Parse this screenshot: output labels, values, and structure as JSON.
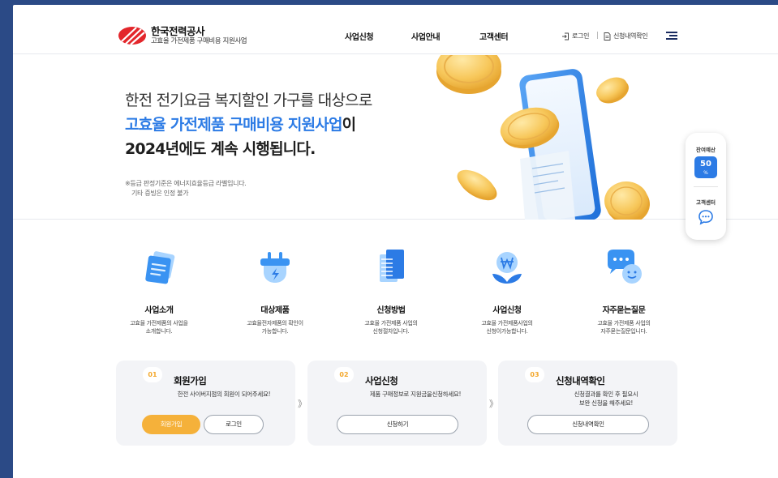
{
  "header": {
    "logo_title": "한국전력공사",
    "logo_subtitle": "고효율 가전제품 구매비용 지원사업",
    "nav": [
      "사업신청",
      "사업안내",
      "고객센터"
    ],
    "login_label": "로그인",
    "history_label": "신청내역확인"
  },
  "hero": {
    "line1": "한전 전기요금 복지할인 가구를 대상으로",
    "line2_highlight": "고효율 가전제품 구매비용 지원사업",
    "line2_suffix": "이",
    "line3": "2024년에도 계속 시행됩니다.",
    "note1": "※등급 판정기준은 에너지효율등급 라벨입니다.",
    "note2": "기타 증빙은 인정 불가"
  },
  "sidepanel": {
    "budget_label": "잔여예산",
    "budget_value": "50",
    "budget_unit": "%",
    "support_label": "고객센터"
  },
  "menu": [
    {
      "title": "사업소개",
      "desc1": "고효율 가전제품의 사업을",
      "desc2": "소개합니다."
    },
    {
      "title": "대상제품",
      "desc1": "고효율전자제품의 확인이",
      "desc2": "가능합니다."
    },
    {
      "title": "신청방법",
      "desc1": "고효율 가전제품 사업의",
      "desc2": "신청절차입니다."
    },
    {
      "title": "사업신청",
      "desc1": "고효율 가전제품사업의",
      "desc2": "신청이가능합니다."
    },
    {
      "title": "자주묻는질문",
      "desc1": "고효율 가전제품 사업의",
      "desc2": "자주묻는질문입니다."
    }
  ],
  "steps": [
    {
      "num": "01",
      "title": "회원가입",
      "desc1": "한전 사이버지점의 회원이 되어주세요!",
      "desc2": "",
      "btn1": "회원가입",
      "btn2": "로그인"
    },
    {
      "num": "02",
      "title": "사업신청",
      "desc1": "제품 구매정보로 지원금을신청하세요!",
      "desc2": "",
      "btn1": "신청하기"
    },
    {
      "num": "03",
      "title": "신청내역확인",
      "desc1": "신청결과를 확인 후 필요시",
      "desc2": "보완 신청을 해주세요!",
      "btn1": "신청내역확인"
    }
  ],
  "step_separator": "》",
  "colors": {
    "accent_blue": "#2c7be5",
    "accent_orange": "#f5b13a",
    "brand_red": "#e3262b",
    "background": "#2b4a86"
  }
}
